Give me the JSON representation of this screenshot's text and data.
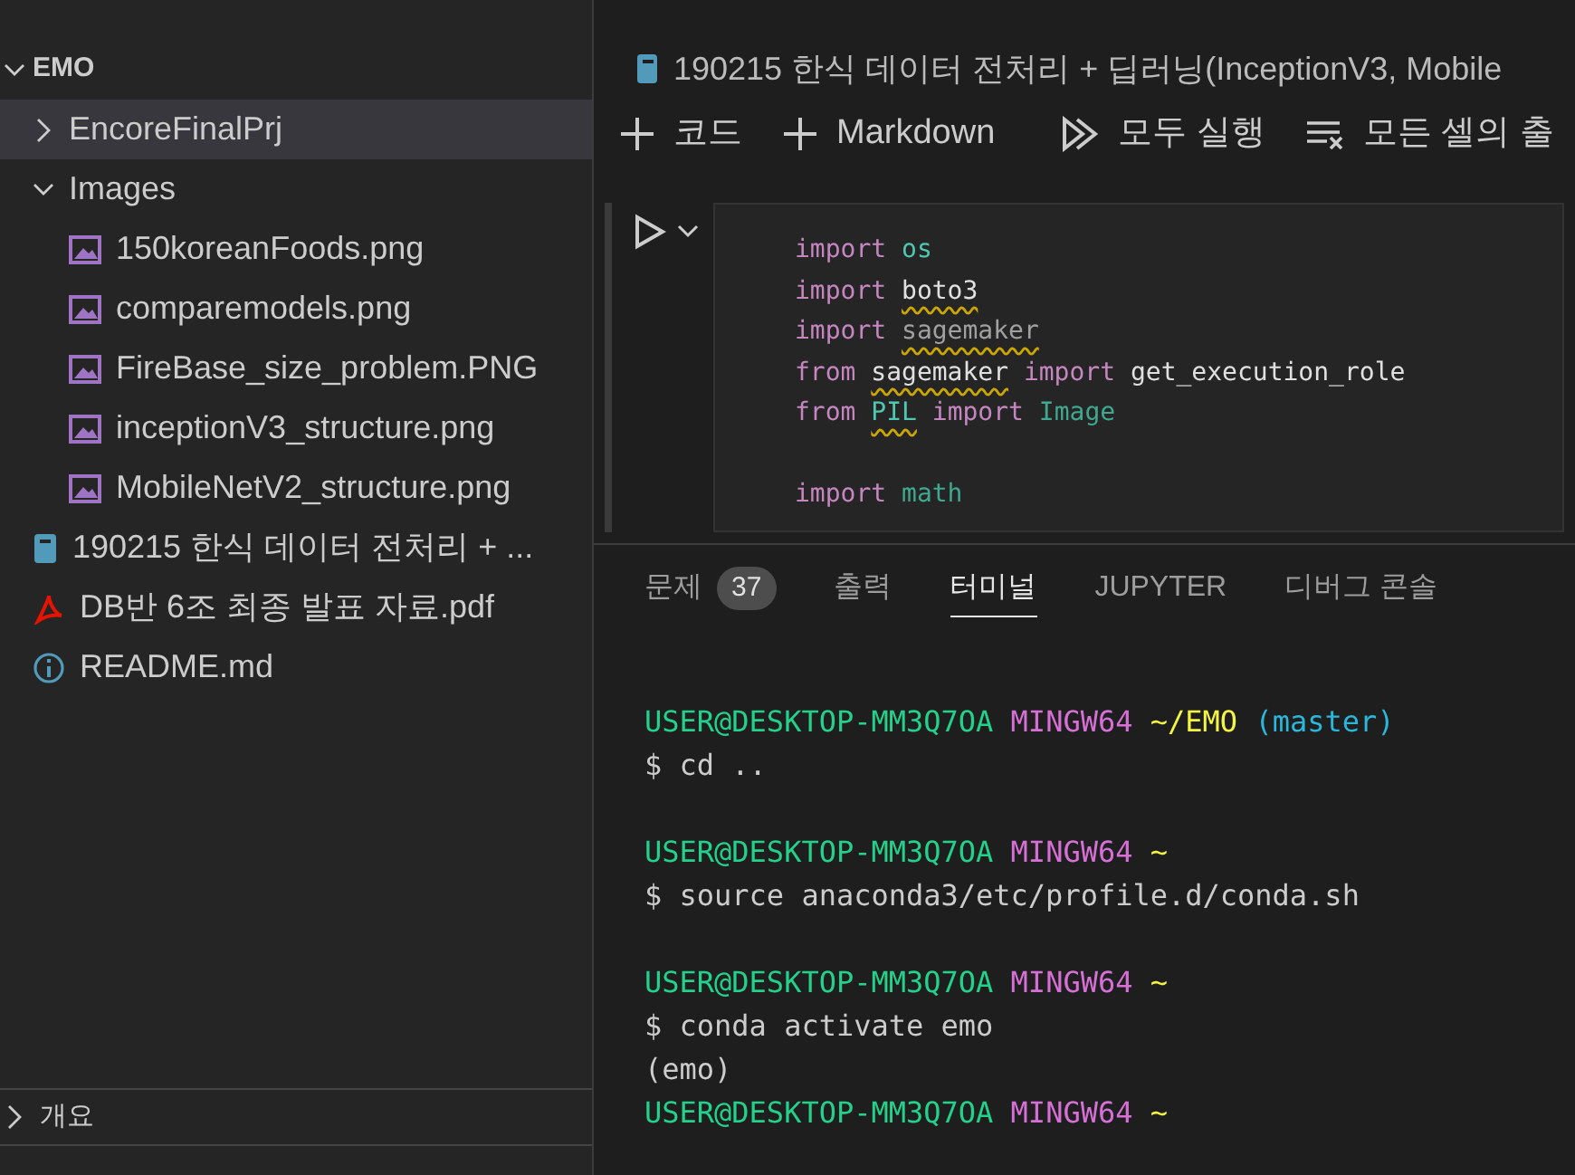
{
  "explorer": {
    "root": {
      "label": "EMO",
      "expanded": true
    },
    "items": [
      {
        "label": "EncoreFinalPrj",
        "kind": "folder",
        "expanded": false,
        "selected": true
      },
      {
        "label": "Images",
        "kind": "folder",
        "expanded": true,
        "selected": false,
        "children": [
          {
            "label": "150koreanFoods.png",
            "kind": "image",
            "selected": false
          },
          {
            "label": "comparemodels.png",
            "kind": "image",
            "selected": false
          },
          {
            "label": "FireBase_size_problem.PNG",
            "kind": "image",
            "selected": false
          },
          {
            "label": "inceptionV3_structure.png",
            "kind": "image",
            "selected": false
          },
          {
            "label": "MobileNetV2_structure.png",
            "kind": "image",
            "selected": false
          }
        ]
      },
      {
        "label": "190215 한식 데이터 전처리 + ...",
        "kind": "notebook",
        "selected": false
      },
      {
        "label": "DB반 6조 최종 발표 자료.pdf",
        "kind": "pdf",
        "selected": false
      },
      {
        "label": "README.md",
        "kind": "info",
        "selected": false
      }
    ]
  },
  "sections": [
    {
      "label": "개요",
      "expanded": false
    }
  ],
  "editor": {
    "tab_title": "190215 한식 데이터 전처리 + 딥러닝(InceptionV3, Mobile",
    "toolbar": [
      {
        "label": "코드",
        "kind": "add"
      },
      {
        "label": "Markdown",
        "kind": "add"
      },
      {
        "label": "모두 실행",
        "kind": "run-all"
      },
      {
        "label": "모든 셀의 출",
        "kind": "clear"
      }
    ],
    "cell": {
      "lines": [
        {
          "gap_before": false,
          "tokens": [
            {
              "text": "import",
              "kind": "keyword"
            },
            {
              "text": "os",
              "kind": "module"
            }
          ]
        },
        {
          "gap_before": false,
          "tokens": [
            {
              "text": "import",
              "kind": "keyword"
            },
            {
              "text": "boto3",
              "kind": "name",
              "warning": true
            }
          ]
        },
        {
          "gap_before": false,
          "tokens": [
            {
              "text": "import",
              "kind": "keyword"
            },
            {
              "text": "sagemaker",
              "kind": "unused",
              "warning": true
            }
          ]
        },
        {
          "gap_before": false,
          "tokens": [
            {
              "text": "from",
              "kind": "keyword"
            },
            {
              "text": "sagemaker",
              "kind": "name",
              "warning": true
            },
            {
              "text": "import",
              "kind": "keyword"
            },
            {
              "text": "get_execution_role",
              "kind": "name"
            }
          ]
        },
        {
          "gap_before": false,
          "tokens": [
            {
              "text": "from",
              "kind": "keyword"
            },
            {
              "text": "PIL",
              "kind": "module",
              "warning": true
            },
            {
              "text": "import",
              "kind": "keyword"
            },
            {
              "text": "Image",
              "kind": "class"
            }
          ]
        },
        {
          "gap_before": true,
          "tokens": [
            {
              "text": "import",
              "kind": "keyword"
            },
            {
              "text": "math",
              "kind": "class"
            }
          ]
        }
      ]
    }
  },
  "panel": {
    "tabs": [
      {
        "label": "문제",
        "badge": "37",
        "selected": false
      },
      {
        "label": "출력",
        "selected": false
      },
      {
        "label": "터미널",
        "selected": true
      },
      {
        "label": "JUPYTER",
        "selected": false
      },
      {
        "label": "디버그 콘솔",
        "selected": false
      }
    ],
    "terminal": [
      {
        "gap_before": false,
        "tokens": [
          {
            "text": "USER@DESKTOP-MM3Q7OA",
            "kind": "user"
          },
          {
            "text": "MINGW64",
            "kind": "host"
          },
          {
            "text": "~/EMO",
            "kind": "path"
          },
          {
            "text": "(master)",
            "kind": "branch"
          }
        ]
      },
      {
        "gap_before": false,
        "tokens": [
          {
            "text": "$ cd ..",
            "kind": "plain"
          }
        ]
      },
      {
        "gap_before": true,
        "tokens": [
          {
            "text": "USER@DESKTOP-MM3Q7OA",
            "kind": "user"
          },
          {
            "text": "MINGW64",
            "kind": "host"
          },
          {
            "text": "~",
            "kind": "path"
          }
        ]
      },
      {
        "gap_before": false,
        "tokens": [
          {
            "text": "$ source anaconda3/etc/profile.d/conda.sh",
            "kind": "plain"
          }
        ]
      },
      {
        "gap_before": true,
        "tokens": [
          {
            "text": "USER@DESKTOP-MM3Q7OA",
            "kind": "user"
          },
          {
            "text": "MINGW64",
            "kind": "host"
          },
          {
            "text": "~",
            "kind": "path"
          }
        ]
      },
      {
        "gap_before": false,
        "tokens": [
          {
            "text": "$ conda activate emo",
            "kind": "plain"
          }
        ]
      },
      {
        "gap_before": false,
        "tokens": [
          {
            "text": "(emo)",
            "kind": "plain"
          }
        ]
      },
      {
        "gap_before": false,
        "tokens": [
          {
            "text": "USER@DESKTOP-MM3Q7OA",
            "kind": "user"
          },
          {
            "text": "MINGW64",
            "kind": "host"
          },
          {
            "text": "~",
            "kind": "path"
          }
        ]
      }
    ]
  }
}
